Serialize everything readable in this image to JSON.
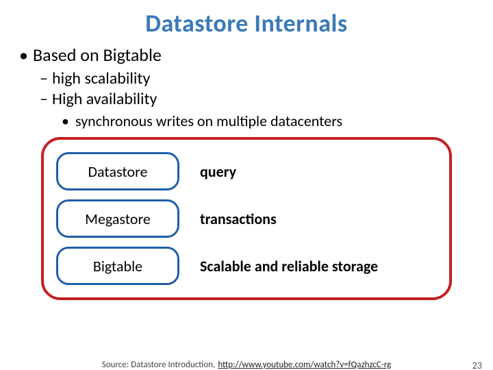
{
  "title": "Datastore Internals",
  "bullets": {
    "l1": "Based on Bigtable",
    "l2a": "high scalability",
    "l2b": "High availability",
    "l3": "synchronous writes on multiple datacenters"
  },
  "bullet_glyphs": {
    "dot": "•",
    "dash": "–"
  },
  "diagram": {
    "rows": [
      {
        "name": "Datastore",
        "desc": "query"
      },
      {
        "name": "Megastore",
        "desc": "transactions"
      },
      {
        "name": "Bigtable",
        "desc": "Scalable and reliable storage"
      }
    ]
  },
  "footer": {
    "source_prefix": "Source: Datastore Introduction,",
    "link_text": "http://www.youtube.com/watch?v=fQazhzcC-rg"
  },
  "page_number": "23",
  "colors": {
    "title": "#3a7ab8",
    "accent": "#c42020",
    "pill_border": "#1f5ea8"
  }
}
